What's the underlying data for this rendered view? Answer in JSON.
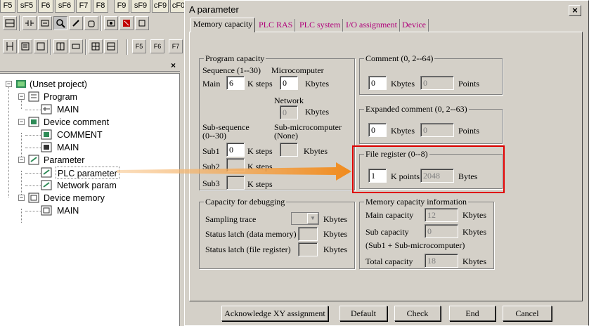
{
  "fkeys": [
    "F5",
    "sF5",
    "F6",
    "sF6",
    "F7",
    "F8",
    "F9",
    "sF9",
    "cF9",
    "cF0",
    "sF"
  ],
  "toolbar2_labels": [
    "F5",
    "F6",
    "F7"
  ],
  "left_pane": {
    "tree": [
      {
        "label": "(Unset project)",
        "icon": "project-icon"
      },
      {
        "label": "Program",
        "icon": "program-folder-icon"
      },
      {
        "label": "MAIN",
        "icon": "ladder-program-icon"
      },
      {
        "label": "Device comment",
        "icon": "comment-folder-icon"
      },
      {
        "label": "COMMENT",
        "icon": "comment-file-icon"
      },
      {
        "label": "MAIN",
        "icon": "comment-file-icon"
      },
      {
        "label": "Parameter",
        "icon": "parameter-folder-icon"
      },
      {
        "label": "PLC parameter",
        "icon": "plc-parameter-icon"
      },
      {
        "label": "Network param",
        "icon": "network-parameter-icon"
      },
      {
        "label": "Device memory",
        "icon": "device-memory-folder-icon"
      },
      {
        "label": "MAIN",
        "icon": "device-memory-file-icon"
      }
    ]
  },
  "dialog": {
    "title": "A parameter",
    "tabs": [
      "Memory capacity",
      "PLC RAS",
      "PLC system",
      "I/O assignment",
      "Device"
    ],
    "program_capacity": {
      "title": "Program capacity",
      "sequence_label": "Sequence (1--30)",
      "microcomputer_label": "Microcomputer",
      "main_label": "Main",
      "main_value": "6",
      "ksteps": "K steps",
      "micro_value": "0",
      "kbytes": "Kbytes",
      "network_label": "Network",
      "network_value": "0",
      "subseq_label1": "Sub-sequence",
      "subseq_label2": "(0--30)",
      "submicro_label1": "Sub-microcomputer",
      "submicro_label2": "(None)",
      "sub1_label": "Sub1",
      "sub1_value": "0",
      "sub2_label": "Sub2",
      "sub3_label": "Sub3"
    },
    "comment": {
      "title": "Comment (0, 2--64)",
      "value": "0",
      "kbytes": "Kbytes",
      "points_value": "0",
      "points": "Points"
    },
    "expanded_comment": {
      "title": "Expanded comment (0, 2--63)",
      "value": "0",
      "kbytes": "Kbytes",
      "points_value": "0",
      "points": "Points"
    },
    "file_register": {
      "title": "File register (0--8)",
      "value": "1",
      "kpoints": "K points",
      "bytes_value": "2048",
      "bytes": "Bytes"
    },
    "debugging": {
      "title": "Capacity for debugging",
      "sampling_trace": "Sampling trace",
      "status_latch_data": "Status latch (data memory)",
      "status_latch_file": "Status latch (file register)",
      "kbytes": "Kbytes"
    },
    "memory_info": {
      "title": "Memory capacity information",
      "main_capacity": "Main capacity",
      "main_value": "12",
      "sub_capacity": "Sub capacity",
      "sub_value": "0",
      "sub_note": "(Sub1 + Sub-microcomputer)",
      "total_capacity": "Total capacity",
      "total_value": "18",
      "kbytes": "Kbytes"
    },
    "buttons": {
      "acknowledge": "Acknowledge XY assignment",
      "default": "Default",
      "check": "Check",
      "end": "End",
      "cancel": "Cancel"
    },
    "close_glyph": "×"
  },
  "colors": {
    "highlight_box": "#e00000",
    "arrow": "#f08a1c",
    "tab_magenta": "#b0007a"
  },
  "pane_close_glyph": "×"
}
